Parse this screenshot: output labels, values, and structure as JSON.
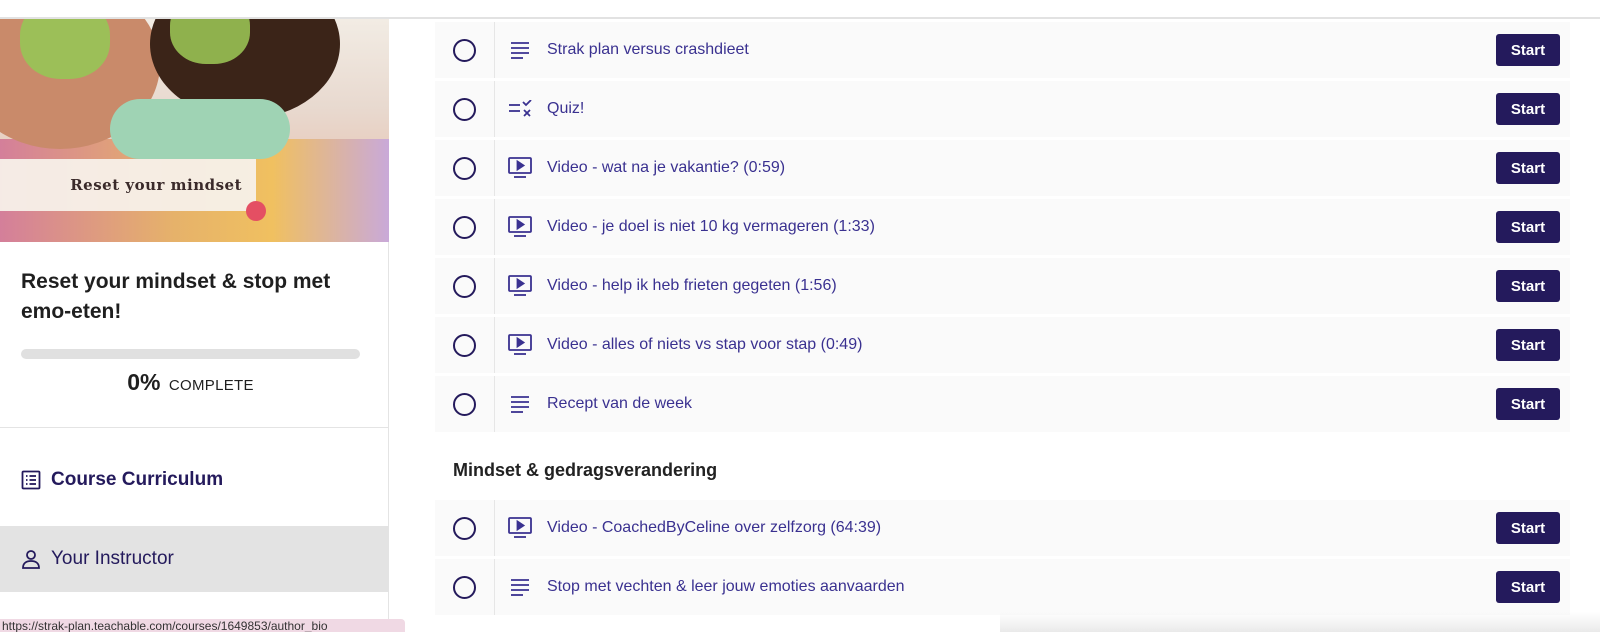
{
  "sidebar": {
    "hero_label": "Reset your mindset",
    "course_title": "Reset your mindset & stop met emo-eten!",
    "progress": {
      "percent": 0,
      "percent_label": "0%",
      "complete_label": "COMPLETE"
    },
    "nav": {
      "curriculum_label": "Course Curriculum",
      "instructor_label": "Your Instructor"
    }
  },
  "lessons_top": [
    {
      "icon": "text-lines-icon",
      "title": "Strak plan versus crashdieet",
      "button": "Start"
    },
    {
      "icon": "quiz-icon",
      "title": "Quiz!",
      "button": "Start"
    },
    {
      "icon": "video-icon",
      "title": "Video - wat na je vakantie? (0:59)",
      "button": "Start"
    },
    {
      "icon": "video-icon",
      "title": "Video - je doel is niet 10 kg vermageren (1:33)",
      "button": "Start"
    },
    {
      "icon": "video-icon",
      "title": "Video - help ik heb frieten gegeten (1:56)",
      "button": "Start"
    },
    {
      "icon": "video-icon",
      "title": "Video - alles of niets vs stap voor stap (0:49)",
      "button": "Start"
    },
    {
      "icon": "text-lines-icon",
      "title": "Recept van de week",
      "button": "Start"
    }
  ],
  "section2": {
    "title": "Mindset & gedragsverandering",
    "lessons": [
      {
        "icon": "video-icon",
        "title": "Video - CoachedByCeline over zelfzorg (64:39)",
        "button": "Start"
      },
      {
        "icon": "text-lines-icon",
        "title": "Stop met vechten & leer jouw emoties aanvaarden",
        "button": "Start"
      }
    ]
  },
  "status_bar": {
    "url": "https://strak-plan.teachable.com/courses/1649853/author_bio"
  },
  "colors": {
    "brand": "#241a5c",
    "lesson_text": "#3a3190",
    "row_bg": "#fafafa"
  }
}
